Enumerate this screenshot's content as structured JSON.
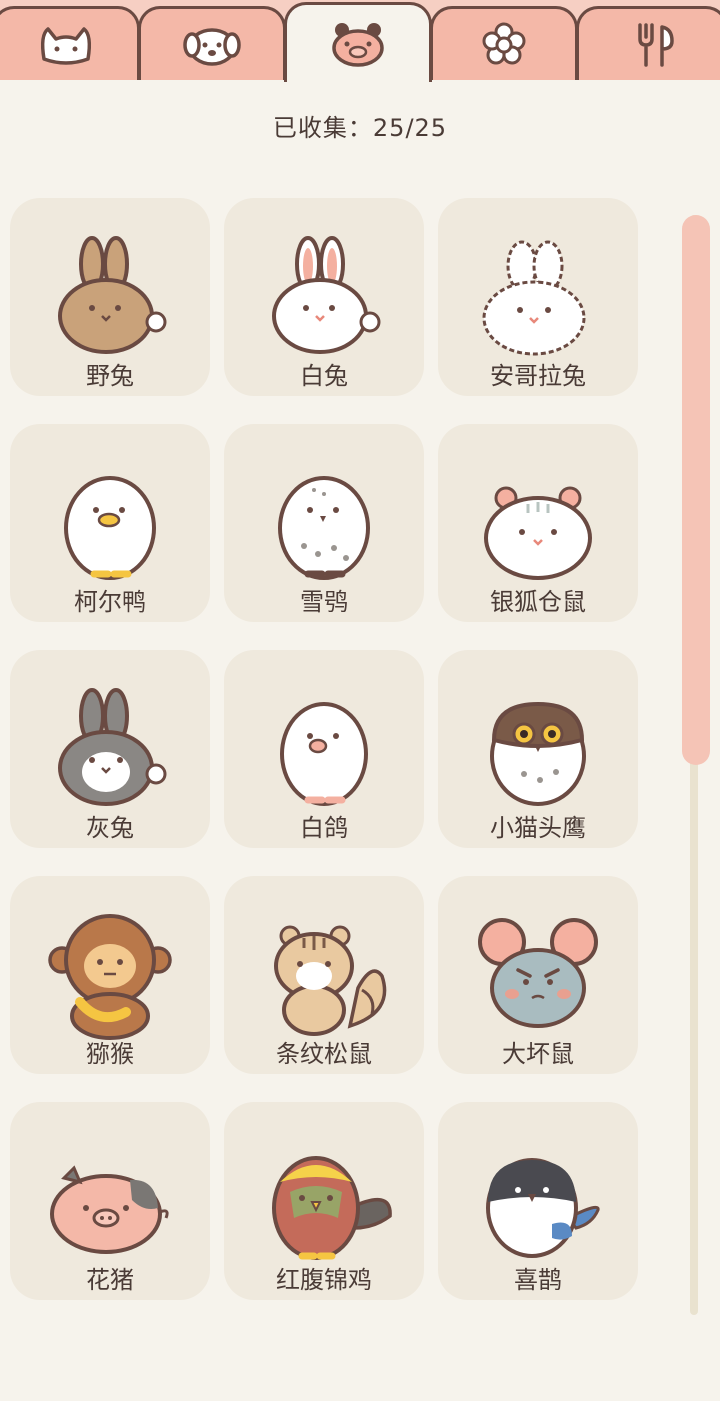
{
  "tabs": [
    {
      "name": "cat-tab",
      "icon": "cat-face-icon"
    },
    {
      "name": "dog-tab",
      "icon": "dog-face-icon"
    },
    {
      "name": "pig-tab",
      "icon": "pig-face-icon",
      "active": true
    },
    {
      "name": "flower-tab",
      "icon": "flower-icon"
    },
    {
      "name": "food-tab",
      "icon": "fork-spoon-icon"
    }
  ],
  "counter": {
    "label": "已收集：25/25"
  },
  "animals": [
    {
      "name": "野兔"
    },
    {
      "name": "白兔"
    },
    {
      "name": "安哥拉兔"
    },
    {
      "name": "柯尔鸭"
    },
    {
      "name": "雪鸮"
    },
    {
      "name": "银狐仓鼠"
    },
    {
      "name": "灰兔"
    },
    {
      "name": "白鸽"
    },
    {
      "name": "小猫头鹰"
    },
    {
      "name": "猕猴"
    },
    {
      "name": "条纹松鼠"
    },
    {
      "name": "大坏鼠"
    },
    {
      "name": "花猪"
    },
    {
      "name": "红腹锦鸡"
    },
    {
      "name": "喜鹊"
    }
  ],
  "colors": {
    "accent": "#f4b8a8",
    "background": "#f6f3ec",
    "card": "#efe9dd",
    "text": "#4a3b36"
  }
}
